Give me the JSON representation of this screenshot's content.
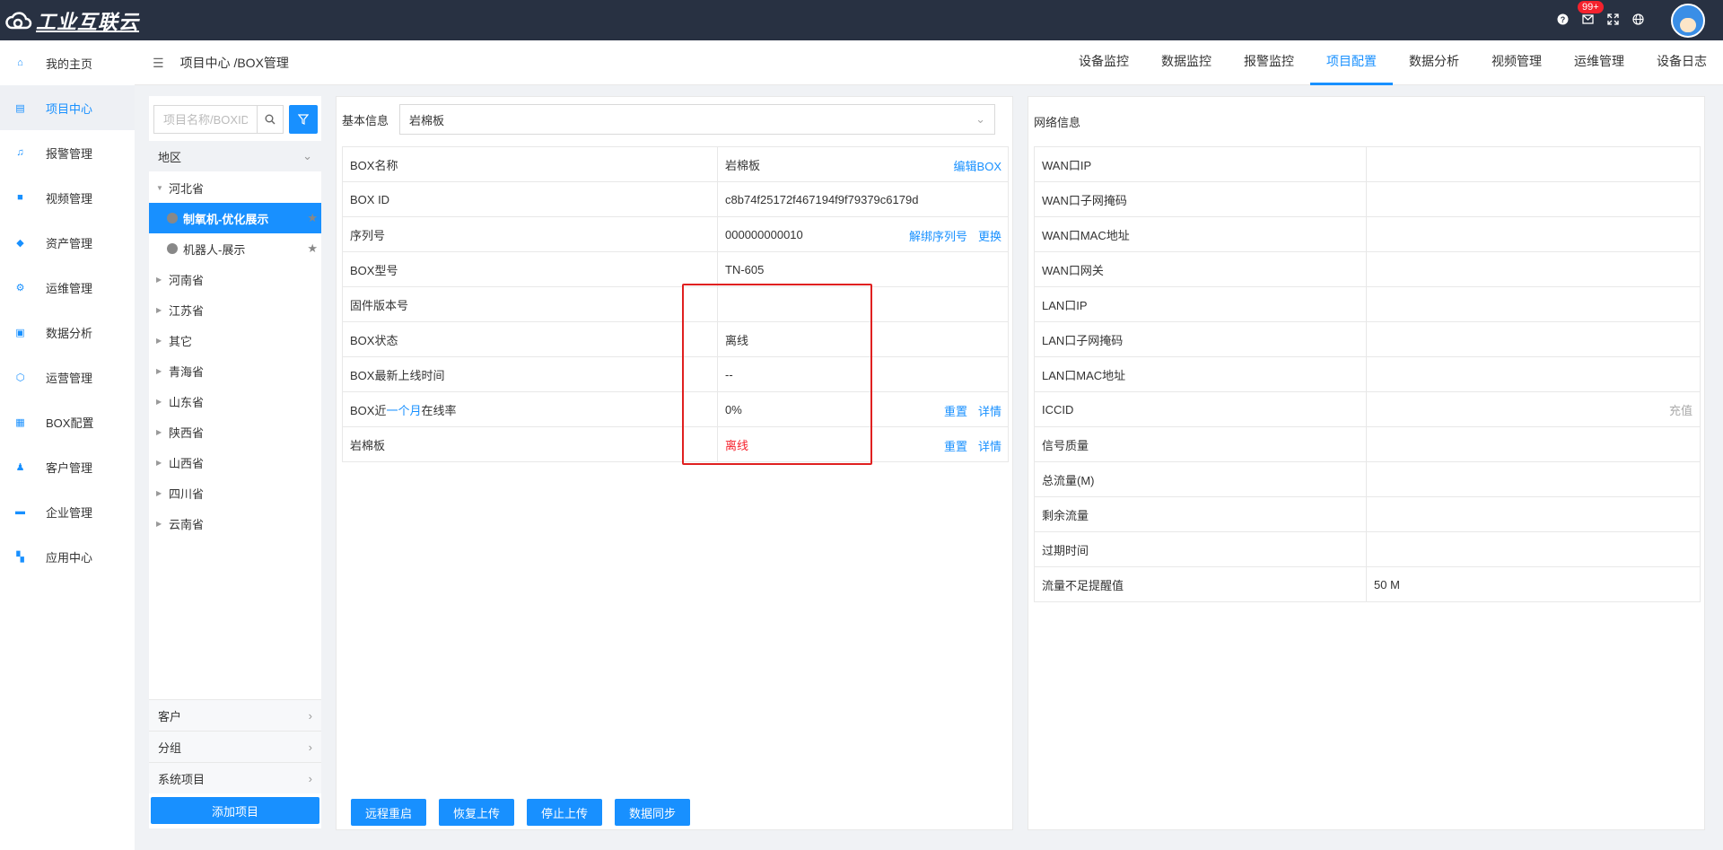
{
  "app": {
    "title": "工业互联云"
  },
  "topbar": {
    "badge": "99+"
  },
  "sidebar": {
    "items": [
      {
        "label": "我的主页",
        "icon": "home-icon"
      },
      {
        "label": "项目中心",
        "icon": "project-icon"
      },
      {
        "label": "报警管理",
        "icon": "bell-icon"
      },
      {
        "label": "视频管理",
        "icon": "video-icon"
      },
      {
        "label": "资产管理",
        "icon": "asset-icon"
      },
      {
        "label": "运维管理",
        "icon": "gear-icon"
      },
      {
        "label": "数据分析",
        "icon": "chart-icon"
      },
      {
        "label": "运营管理",
        "icon": "shield-icon"
      },
      {
        "label": "BOX配置",
        "icon": "box-icon"
      },
      {
        "label": "客户管理",
        "icon": "users-icon"
      },
      {
        "label": "企业管理",
        "icon": "briefcase-icon"
      },
      {
        "label": "应用中心",
        "icon": "apps-icon"
      }
    ],
    "active_index": 1
  },
  "breadcrumb": "项目中心 /BOX管理",
  "tabs": [
    "设备监控",
    "数据监控",
    "报警监控",
    "项目配置",
    "数据分析",
    "视频管理",
    "运维管理",
    "设备日志"
  ],
  "active_tab": "项目配置",
  "tree": {
    "search_placeholder": "项目名称/BOXID",
    "region_label": "地区",
    "provinces": [
      "河北省",
      "河南省",
      "江苏省",
      "其它",
      "青海省",
      "山东省",
      "陕西省",
      "山西省",
      "四川省",
      "云南省"
    ],
    "hebei_children": [
      "制氧机-优化展示",
      "机器人-展示"
    ],
    "sections": [
      "客户",
      "分组",
      "系统项目"
    ],
    "add_button": "添加项目"
  },
  "basic": {
    "label": "基本信息",
    "selected": "岩棉板",
    "rows": {
      "name_label": "BOX名称",
      "name_value": "岩棉板",
      "name_action": "编辑BOX",
      "id_label": "BOX ID",
      "id_value": "c8b74f25172f467194f9f79379c6179d",
      "serial_label": "序列号",
      "serial_value": "000000000010",
      "serial_unbind": "解绑序列号",
      "serial_replace": "更换",
      "model_label": "BOX型号",
      "model_value": "TN-605",
      "firmware_label": "固件版本号",
      "firmware_value": "",
      "status_label": "BOX状态",
      "status_value": "离线",
      "lastonline_label": "BOX最新上线时间",
      "lastonline_value": "--",
      "rate_label_a": "BOX近",
      "rate_label_b": "一个月",
      "rate_label_c": "在线率",
      "rate_value": "0%",
      "reset": "重置",
      "detail": "详情",
      "device_label": "岩棉板",
      "device_value": "离线"
    },
    "buttons": [
      "远程重启",
      "恢复上传",
      "停止上传",
      "数据同步"
    ]
  },
  "network": {
    "title": "网络信息",
    "rows": [
      {
        "label": "WAN口IP",
        "value": ""
      },
      {
        "label": "WAN口子网掩码",
        "value": ""
      },
      {
        "label": "WAN口MAC地址",
        "value": ""
      },
      {
        "label": "WAN口网关",
        "value": ""
      },
      {
        "label": "LAN口IP",
        "value": ""
      },
      {
        "label": "LAN口子网掩码",
        "value": ""
      },
      {
        "label": "LAN口MAC地址",
        "value": ""
      },
      {
        "label": "ICCID",
        "value": ""
      },
      {
        "label": "信号质量",
        "value": ""
      },
      {
        "label": "总流量(M)",
        "value": ""
      },
      {
        "label": "剩余流量",
        "value": ""
      },
      {
        "label": "过期时间",
        "value": ""
      },
      {
        "label": "流量不足提醒值",
        "value": "50  M"
      }
    ],
    "recharge": "充值"
  },
  "colors": {
    "accent": "#1890ff",
    "topbar": "#283142",
    "offline": "#f5222d",
    "highlight": "#e02020"
  }
}
